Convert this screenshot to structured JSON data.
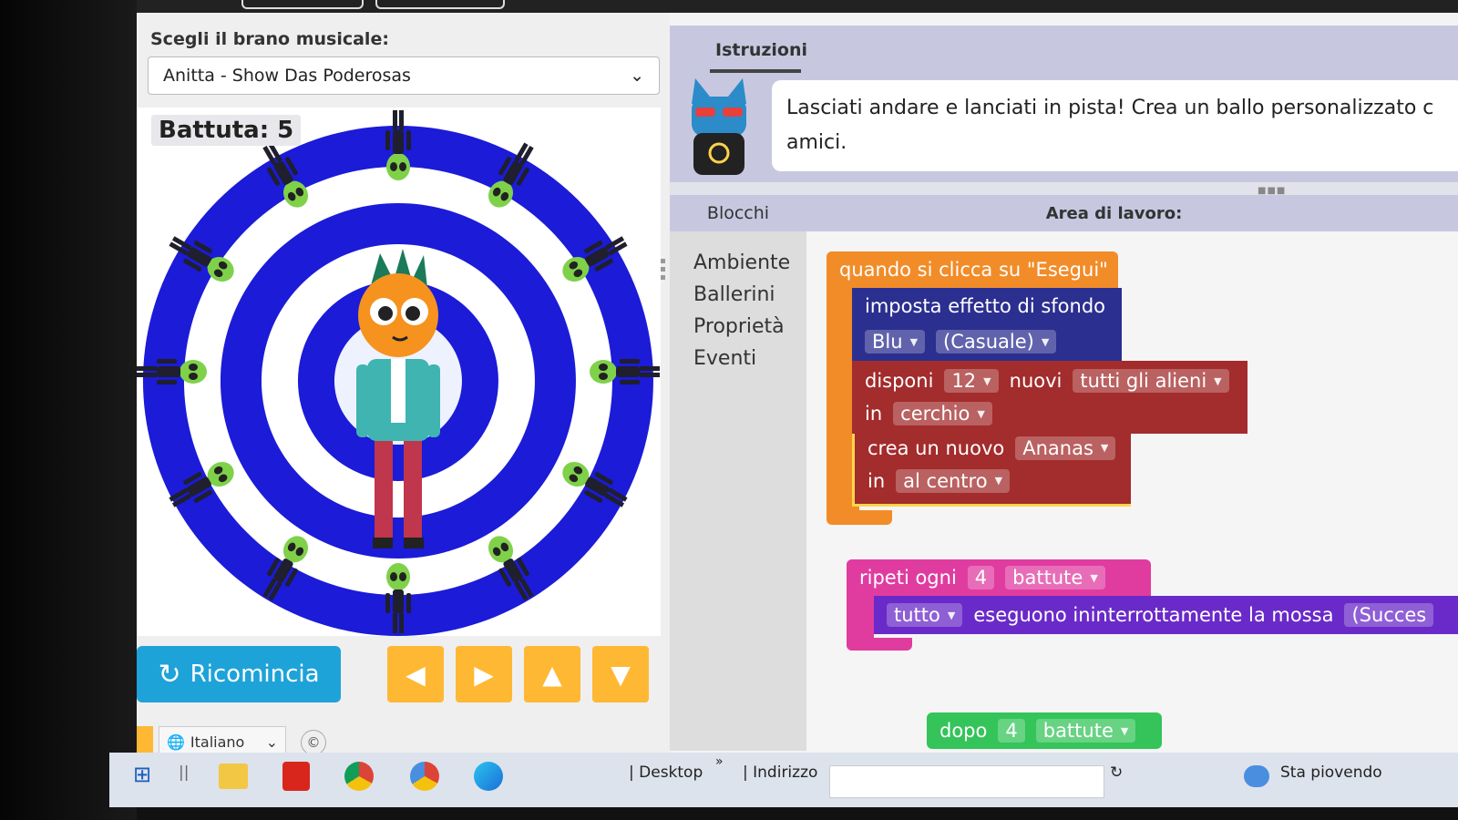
{
  "song": {
    "label": "Scegli il brano musicale:",
    "selected": "Anitta - Show Das Poderosas"
  },
  "stage": {
    "beat_label": "Battuta: 5",
    "dancer_count": 12
  },
  "controls": {
    "restart_label": "Ricomincia",
    "left": "◀",
    "right": "▶",
    "up": "▲",
    "down": "▼"
  },
  "footer": {
    "language": "Italiano",
    "copyright": "©"
  },
  "instructions": {
    "tab": "Istruzioni",
    "text_line1": "Lasciati andare e lanciati in pista! Crea un ballo personalizzato c",
    "text_line2": "amici."
  },
  "panels": {
    "blocks": "Blocchi",
    "workspace": "Area di lavoro:"
  },
  "toolbox": [
    "Ambiente",
    "Ballerini",
    "Proprietà",
    "Eventi"
  ],
  "code": {
    "event": "quando si clicca su \"Esegui\"",
    "bg_label": "imposta effetto di sfondo",
    "bg_color": "Blu",
    "bg_palette": "(Casuale)",
    "arrange": "disponi",
    "arrange_count": "12",
    "arrange_new": "nuovi",
    "arrange_type": "tutti gli alieni",
    "arrange_in": "in",
    "arrange_layout": "cerchio",
    "create": "crea un nuovo",
    "create_type": "Ananas",
    "create_in": "in",
    "create_location": "al centro",
    "repeat": "ripeti ogni",
    "repeat_count": "4",
    "repeat_unit": "battute",
    "all": "tutto",
    "move_text": "eseguono ininterrottamente la mossa",
    "move_value": "(Succes",
    "after": "dopo",
    "after_count": "4",
    "after_unit": "battute"
  },
  "taskbar": {
    "desktop": "Desktop",
    "address": "Indirizzo",
    "weather": "Sta piovendo",
    "chevron": "»"
  },
  "colors": {
    "event": "#f28c28",
    "background": "#2b2f8f",
    "arrange": "#a32c2c",
    "repeat": "#e03ca0",
    "repeat_inner": "#6a2ac9",
    "after": "#34c45a",
    "restart": "#1ea3d9",
    "arrow": "#ffb833",
    "spiral": "#1b1bd8"
  }
}
